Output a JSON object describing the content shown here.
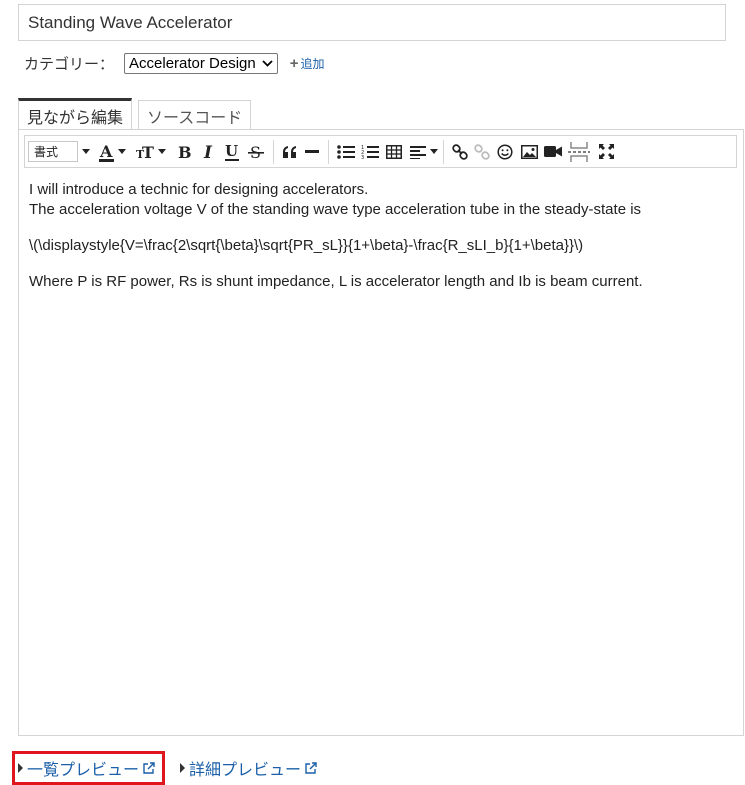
{
  "title_field": {
    "value": "Standing Wave Accelerator"
  },
  "category": {
    "label": "カテゴリー：",
    "selected": "Accelerator Design",
    "add_label": "追加"
  },
  "tabs": [
    {
      "label": "見ながら編集",
      "active": true
    },
    {
      "label": "ソースコード",
      "active": false
    }
  ],
  "toolbar": {
    "format_label": "書式",
    "buttons": [
      "font-color",
      "font-size",
      "bold",
      "italic",
      "underline",
      "strikethrough",
      "blockquote",
      "horizontal-rule",
      "bullet-list",
      "numbered-list",
      "table",
      "align",
      "link",
      "unlink",
      "emoji",
      "image",
      "video",
      "page-break",
      "fullscreen"
    ]
  },
  "content": {
    "line1": "I will introduce a technic for designing accelerators.",
    "line2": "The acceleration voltage V of the standing wave type acceleration tube in the steady-state is",
    "line3": "\\(\\displaystyle{V=\\frac{2\\sqrt{\\beta}\\sqrt{PR_sL}}{1+\\beta}-\\frac{R_sLI_b}{1+\\beta}}\\)",
    "line4": "Where P is RF power, Rs is shunt impedance, L is accelerator length and Ib is beam current."
  },
  "previews": {
    "list_preview": "一覧プレビュー",
    "detail_preview": "詳細プレビュー"
  },
  "colors": {
    "link": "#1a5fa8",
    "highlight_border": "#e0161f",
    "border": "#d4d4d4"
  }
}
